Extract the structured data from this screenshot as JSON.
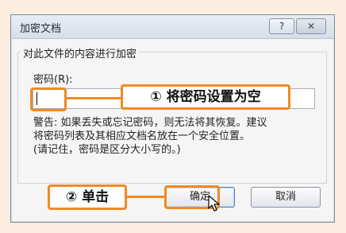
{
  "dialog": {
    "title": "加密文档",
    "help_label": "?",
    "close_label": "✕",
    "group_label": "对此文件的内容进行加密",
    "password_label": "密码(R):",
    "password_value": "",
    "warning_line1": "警告: 如果丢失或忘记密码，则无法将其恢复。建议",
    "warning_line2": "将密码列表及其相应文档名放在一个安全位置。",
    "warning_line3": "(请记住，密码是区分大小写的。)",
    "ok_label": "确定",
    "cancel_label": "取消"
  },
  "annotations": {
    "step1": "① 将密码设置为空",
    "step2": "② 单击"
  },
  "colors": {
    "accent": "#f08a24",
    "page_background": "#fbeee0"
  }
}
